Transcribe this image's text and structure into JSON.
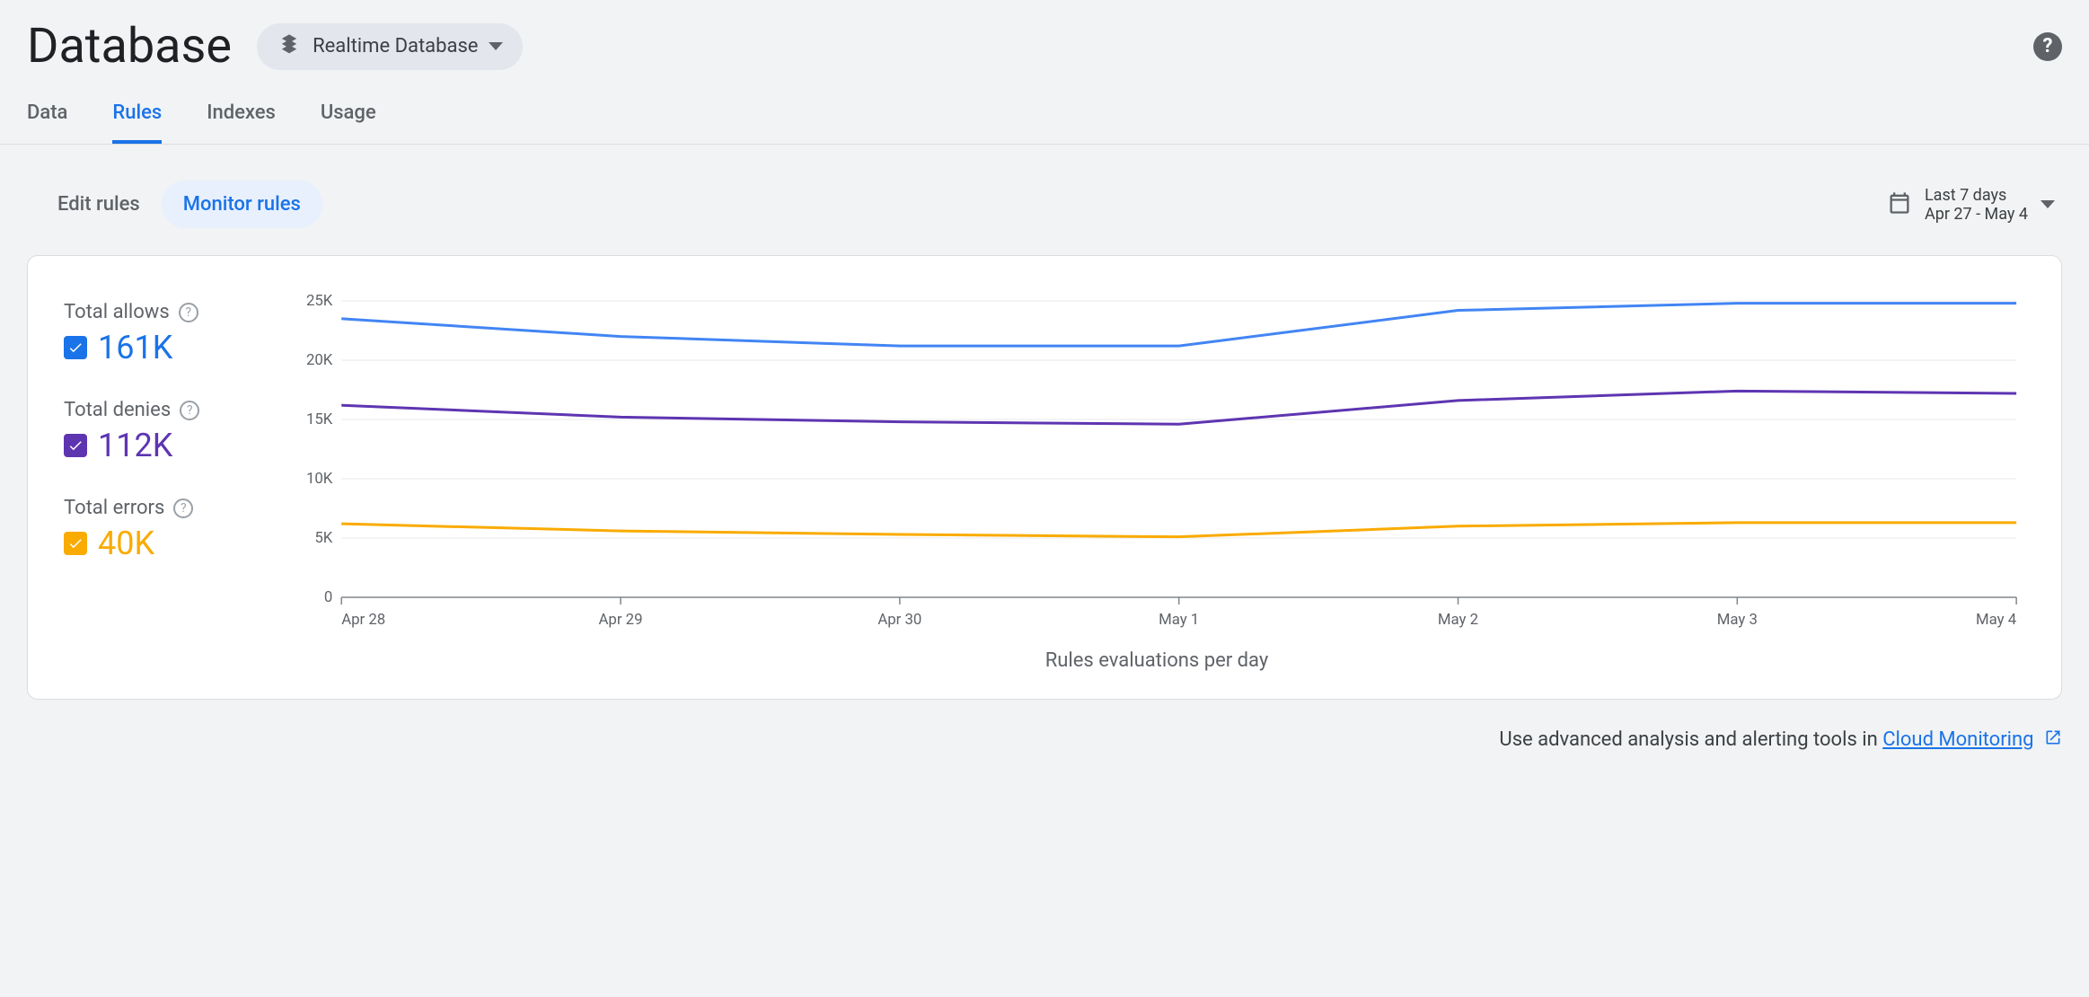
{
  "header": {
    "title": "Database",
    "db_selector_label": "Realtime Database"
  },
  "tabs": [
    {
      "label": "Data",
      "active": false
    },
    {
      "label": "Rules",
      "active": true
    },
    {
      "label": "Indexes",
      "active": false
    },
    {
      "label": "Usage",
      "active": false
    }
  ],
  "subtabs": {
    "edit": "Edit rules",
    "monitor": "Monitor rules"
  },
  "date_picker": {
    "range_label": "Last 7 days",
    "range_dates": "Apr 27 - May 4"
  },
  "legend": {
    "allows": {
      "label": "Total allows",
      "value": "161K",
      "color": "#1a73e8"
    },
    "denies": {
      "label": "Total denies",
      "value": "112K",
      "color": "#5e35b1"
    },
    "errors": {
      "label": "Total errors",
      "value": "40K",
      "color": "#f9ab00"
    }
  },
  "chart_data": {
    "type": "line",
    "title": "Rules evaluations per day",
    "xlabel": "",
    "ylabel": "",
    "ylim": [
      0,
      25000
    ],
    "y_ticks": [
      "0",
      "5K",
      "10K",
      "15K",
      "20K",
      "25K"
    ],
    "categories": [
      "Apr 28",
      "Apr 29",
      "Apr 30",
      "May 1",
      "May 2",
      "May 3",
      "May 4"
    ],
    "series": [
      {
        "name": "allows",
        "color": "#4285f4",
        "values": [
          23500,
          22000,
          21200,
          21200,
          24200,
          24800,
          24800
        ]
      },
      {
        "name": "denies",
        "color": "#5e35b1",
        "values": [
          16200,
          15200,
          14800,
          14600,
          16600,
          17400,
          17200
        ]
      },
      {
        "name": "errors",
        "color": "#f9ab00",
        "values": [
          6200,
          5600,
          5300,
          5100,
          6000,
          6300,
          6300
        ]
      }
    ]
  },
  "footer": {
    "text": "Use advanced analysis and alerting tools in ",
    "link_text": "Cloud Monitoring"
  }
}
